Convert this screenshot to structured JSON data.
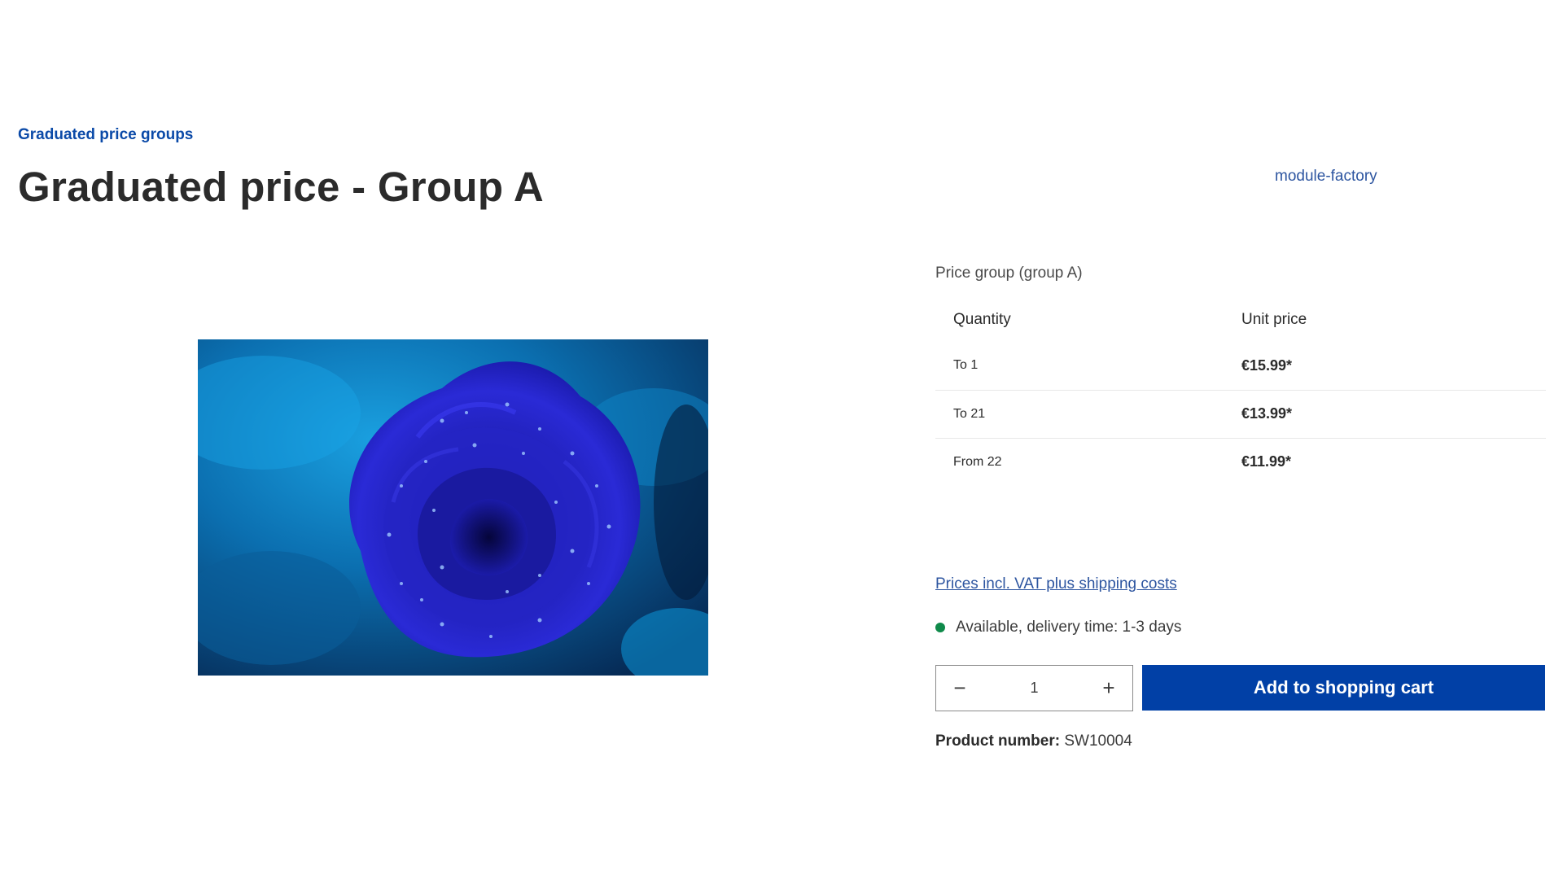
{
  "breadcrumb": {
    "label": "Graduated price groups"
  },
  "product": {
    "title": "Graduated price - Group A",
    "manufacturer": "module-factory",
    "image_subject": "blue rose with water droplets",
    "product_number_label": "Product number:",
    "product_number": "SW10004"
  },
  "pricing": {
    "group_label": "Price group (group A)",
    "headers": {
      "quantity": "Quantity",
      "unit_price": "Unit price"
    },
    "rows": [
      {
        "quantity": "To 1",
        "price": "€15.99*"
      },
      {
        "quantity": "To 21",
        "price": "€13.99*"
      },
      {
        "quantity": "From 22",
        "price": "€11.99*"
      }
    ],
    "vat_note": "Prices incl. VAT plus shipping costs"
  },
  "availability": {
    "text": "Available, delivery time: 1-3 days",
    "status_color": "#0f8a4a"
  },
  "purchase": {
    "quantity": "1",
    "decrease_icon": "minus-icon",
    "increase_icon": "plus-icon",
    "decrease_glyph": "−",
    "increase_glyph": "+",
    "add_to_cart_label": "Add to shopping cart",
    "button_color": "#0140a6"
  }
}
